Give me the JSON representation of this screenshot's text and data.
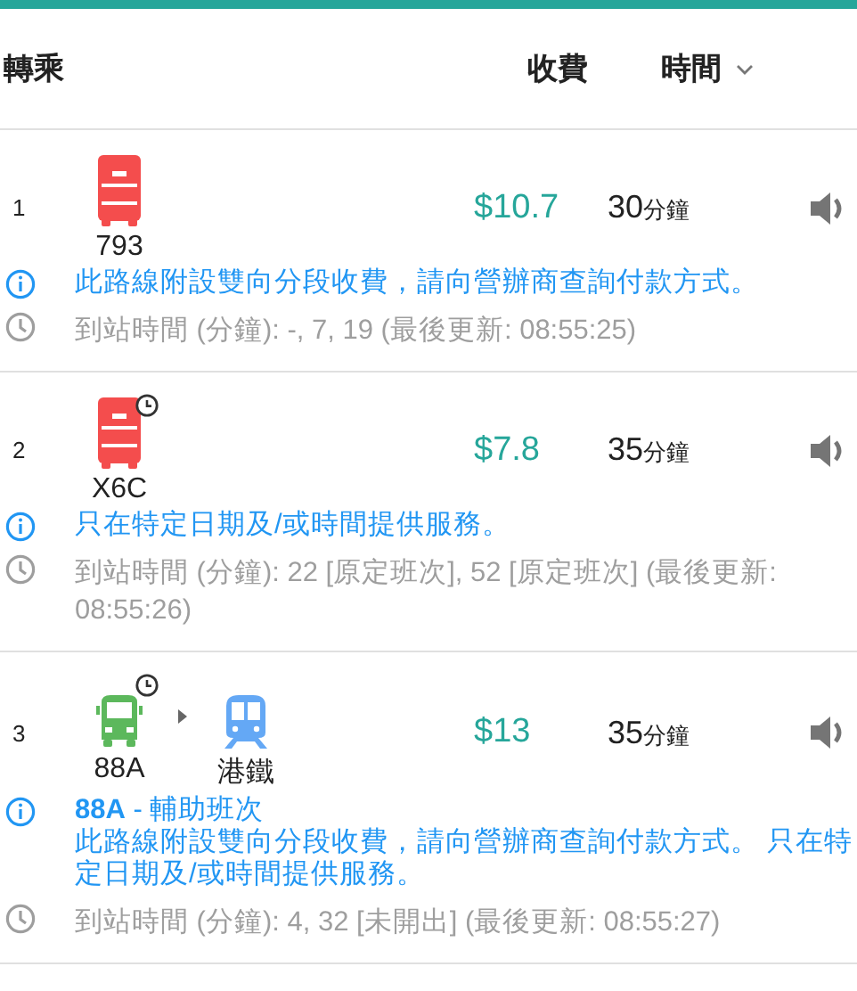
{
  "header": {
    "transfer": "轉乘",
    "fare": "收費",
    "time": "時間"
  },
  "routes": [
    {
      "index": "1",
      "legs": [
        {
          "kind": "bus",
          "route": "793",
          "color": "#f44d4d",
          "scheduled": false
        }
      ],
      "fare": "$10.7",
      "minutes": "30",
      "unit": "分鐘",
      "notices": [
        "此路線附設雙向分段收費，請向營辦商查詢付款方式。"
      ],
      "eta": "到站時間 (分鐘): -, 7, 19 (最後更新: 08:55:25)"
    },
    {
      "index": "2",
      "legs": [
        {
          "kind": "bus",
          "route": "X6C",
          "color": "#f44d4d",
          "scheduled": true
        }
      ],
      "fare": "$7.8",
      "minutes": "35",
      "unit": "分鐘",
      "notices": [
        "只在特定日期及/或時間提供服務。"
      ],
      "eta": "到站時間 (分鐘): 22 [原定班次], 52 [原定班次] (最後更新: 08:55:26)"
    },
    {
      "index": "3",
      "legs": [
        {
          "kind": "minibus",
          "route": "88A",
          "color": "#5cb85c",
          "scheduled": true
        },
        {
          "kind": "rail",
          "route": "港鐵",
          "color": "#64a8f5",
          "scheduled": false
        }
      ],
      "fare": "$13",
      "minutes": "35",
      "unit": "分鐘",
      "notices": [
        "**88A** - 輔助班次",
        "此路線附設雙向分段收費，請向營辦商查詢付款方式。 只在特定日期及/或時間提供服務。"
      ],
      "eta": "到站時間 (分鐘): 4, 32 [未開出] (最後更新: 08:55:27)"
    }
  ]
}
